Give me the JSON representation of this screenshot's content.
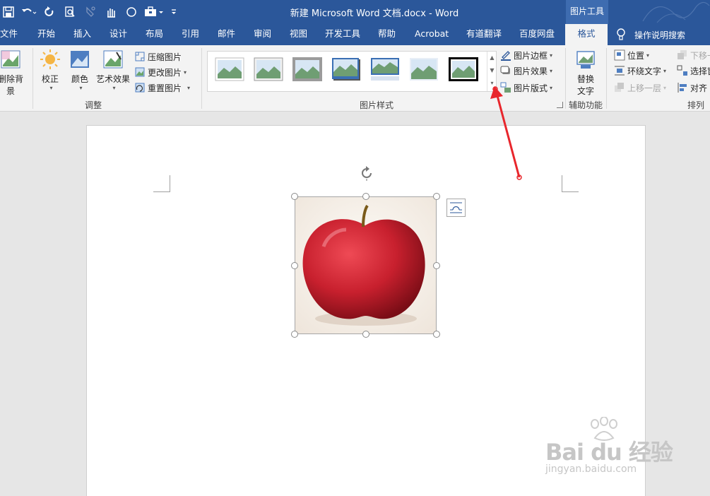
{
  "window": {
    "title": "新建 Microsoft Word 文档.docx  -  Word",
    "context_tools": "图片工具"
  },
  "quick_access": {
    "icons": [
      "save-icon",
      "undo-icon",
      "redo-icon",
      "print-preview-icon",
      "format-painter-icon",
      "touch-mode-icon",
      "circle-icon",
      "toolbox-icon",
      "customize-icon"
    ]
  },
  "tabs": [
    {
      "label": "文件"
    },
    {
      "label": "开始"
    },
    {
      "label": "插入"
    },
    {
      "label": "设计"
    },
    {
      "label": "布局"
    },
    {
      "label": "引用"
    },
    {
      "label": "邮件"
    },
    {
      "label": "审阅"
    },
    {
      "label": "视图"
    },
    {
      "label": "开发工具"
    },
    {
      "label": "帮助"
    },
    {
      "label": "Acrobat"
    },
    {
      "label": "有道翻译"
    },
    {
      "label": "百度网盘"
    },
    {
      "label": "格式"
    }
  ],
  "help_search": "操作说明搜索",
  "ribbon": {
    "adjust": {
      "label": "调整",
      "remove_bg": "删除背景",
      "corrections": "校正",
      "color": "颜色",
      "artistic": "艺术效果",
      "compress": "压缩图片",
      "change": "更改图片",
      "reset": "重置图片"
    },
    "styles": {
      "label": "图片样式",
      "border": "图片边框",
      "effects": "图片效果",
      "layout": "图片版式"
    },
    "accessibility": {
      "label": "辅助功能",
      "alt_text_1": "替换",
      "alt_text_2": "文字"
    },
    "arrange": {
      "label": "排列",
      "position": "位置",
      "wrap": "环绕文字",
      "forward": "上移一层",
      "backward": "下移一",
      "selection": "选择窗",
      "align": "对齐"
    }
  },
  "colors": {
    "brand_blue": "#2b579a",
    "arrow_red": "#e8262c",
    "apple_red": "#c8202e"
  },
  "watermark": {
    "main": "Bai du 经验",
    "sub": "jingyan.baidu.com"
  }
}
